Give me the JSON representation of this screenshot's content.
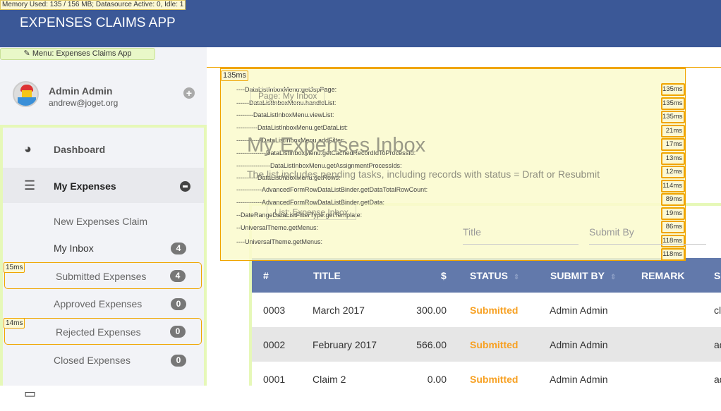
{
  "debug": {
    "memory": "Memory Used: 135 / 156 MB; Datasource Active: 0, Idle: 1",
    "menu_tag": "✎ Menu: Expenses Claims App",
    "total": "135ms",
    "traces": [
      {
        "label": "----DataListInboxMenu.getJspPage:",
        "ms": "135ms"
      },
      {
        "label": "------DataListInboxMenu.handleList:",
        "ms": "135ms"
      },
      {
        "label": "--------DataListInboxMenu.viewList:",
        "ms": "135ms"
      },
      {
        "label": "----------DataListInboxMenu.getDataList:",
        "ms": "21ms"
      },
      {
        "label": "------------DataListInboxMenu.addFilter:",
        "ms": "17ms"
      },
      {
        "label": "--------------DataListInboxMenu.getCachedRecordIdToProcessId:",
        "ms": "13ms"
      },
      {
        "label": "----------------DataListInboxMenu.getAssignmentProcessIds:",
        "ms": "12ms"
      },
      {
        "label": "----------DataListInboxMenu.getRows:",
        "ms": "114ms"
      },
      {
        "label": "------------AdvancedFormRowDataListBinder.getDataTotalRowCount:",
        "ms": "89ms"
      },
      {
        "label": "------------AdvancedFormRowDataListBinder.getData:",
        "ms": "19ms"
      },
      {
        "label": "--DateRangeDataListFilterType.getTemplate:",
        "ms": "86ms"
      },
      {
        "label": "--UniversalTheme.getMenus:",
        "ms": "118ms"
      },
      {
        "label": "----UniversalTheme.getMenus:",
        "ms": "118ms"
      }
    ],
    "sub_ms": [
      "15ms",
      "14ms"
    ]
  },
  "header": {
    "title": "EXPENSES CLAIMS APP"
  },
  "user": {
    "name": "Admin Admin",
    "email": "andrew@joget.org"
  },
  "nav": {
    "dashboard": "Dashboard",
    "my_expenses": "My Expenses",
    "subs": [
      {
        "label": "New Expenses Claim",
        "badge": null
      },
      {
        "label": "My Inbox",
        "badge": "4"
      },
      {
        "label": "Submitted Expenses",
        "badge": "4"
      },
      {
        "label": "Approved Expenses",
        "badge": "0"
      },
      {
        "label": "Rejected Expenses",
        "badge": "0"
      },
      {
        "label": "Closed Expenses",
        "badge": "0"
      }
    ]
  },
  "page": {
    "title": "My Expenses Inbox",
    "desc": "The list includes pending tasks, including records with status = Draft or Resubmit",
    "page_tag": "Page: My Inbox",
    "list_tag": "List: Expense Inbox",
    "filter_title": "Title",
    "filter_submit": "Submit By"
  },
  "table": {
    "headers": [
      "#",
      "TITLE",
      "$",
      "STATUS",
      "SUBMIT BY",
      "REMARK",
      "S"
    ],
    "rows": [
      {
        "no": "0003",
        "title": "March 2017",
        "amount": "300.00",
        "status": "Submitted",
        "by": "Admin Admin",
        "extra": "cl"
      },
      {
        "no": "0002",
        "title": "February 2017",
        "amount": "566.00",
        "status": "Submitted",
        "by": "Admin Admin",
        "extra": "ad"
      },
      {
        "no": "0001",
        "title": "Claim 2",
        "amount": "0.00",
        "status": "Submitted",
        "by": "Admin Admin",
        "extra": "ad"
      }
    ]
  }
}
